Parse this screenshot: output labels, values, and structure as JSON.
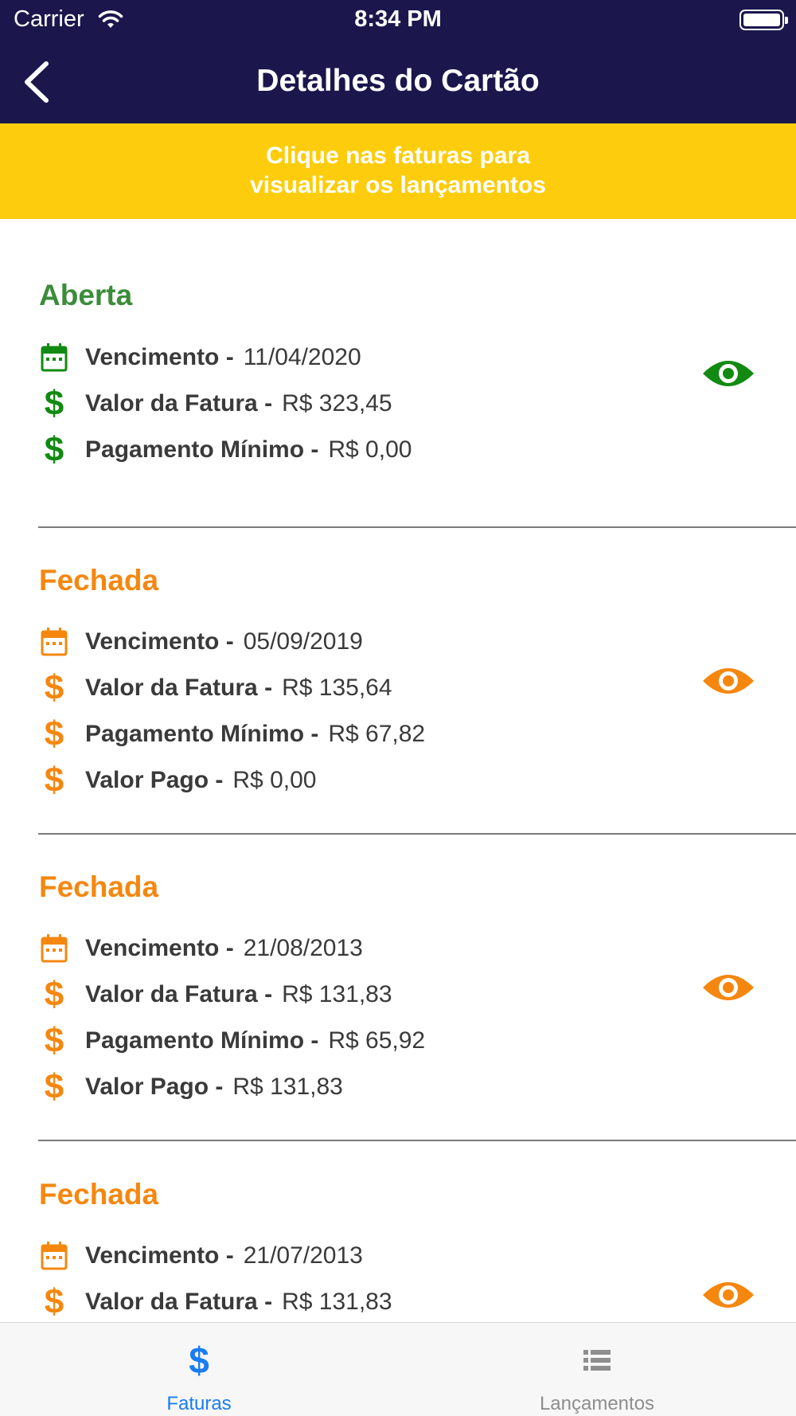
{
  "status_bar": {
    "carrier": "Carrier",
    "time": "8:34 PM"
  },
  "nav": {
    "title": "Detalhes do Cartão"
  },
  "banner": {
    "line1": "Clique nas faturas para",
    "line2": "visualizar os lançamentos"
  },
  "colors": {
    "navy": "#1b174d",
    "yellow": "#fdcd0d",
    "open_green": "#3b8c3a",
    "closed_orange": "#f5870f",
    "eye_green": "#128a12",
    "tab_active": "#1a7cf2",
    "tab_inactive": "#8e8e8e"
  },
  "invoices": [
    {
      "status": "Aberta",
      "vencimento": {
        "label": "Vencimento -",
        "value": "11/04/2020"
      },
      "valor_fatura": {
        "label": "Valor da Fatura -",
        "value": "R$ 323,45"
      },
      "pagamento_minimo": {
        "label": "Pagamento Mínimo -",
        "value": "R$ 0,00"
      }
    },
    {
      "status": "Fechada",
      "vencimento": {
        "label": "Vencimento -",
        "value": "05/09/2019"
      },
      "valor_fatura": {
        "label": "Valor da Fatura -",
        "value": "R$ 135,64"
      },
      "pagamento_minimo": {
        "label": "Pagamento Mínimo -",
        "value": "R$ 67,82"
      },
      "valor_pago": {
        "label": "Valor Pago -",
        "value": "R$ 0,00"
      }
    },
    {
      "status": "Fechada",
      "vencimento": {
        "label": "Vencimento -",
        "value": "21/08/2013"
      },
      "valor_fatura": {
        "label": "Valor da Fatura -",
        "value": "R$ 131,83"
      },
      "pagamento_minimo": {
        "label": "Pagamento Mínimo -",
        "value": "R$ 65,92"
      },
      "valor_pago": {
        "label": "Valor Pago -",
        "value": "R$ 131,83"
      }
    },
    {
      "status": "Fechada",
      "vencimento": {
        "label": "Vencimento -",
        "value": "21/07/2013"
      },
      "valor_fatura": {
        "label": "Valor da Fatura -",
        "value": "R$ 131,83"
      }
    }
  ],
  "tabs": [
    {
      "label": "Faturas",
      "icon": "dollar-icon",
      "active": true
    },
    {
      "label": "Lançamentos",
      "icon": "list-icon",
      "active": false
    }
  ]
}
